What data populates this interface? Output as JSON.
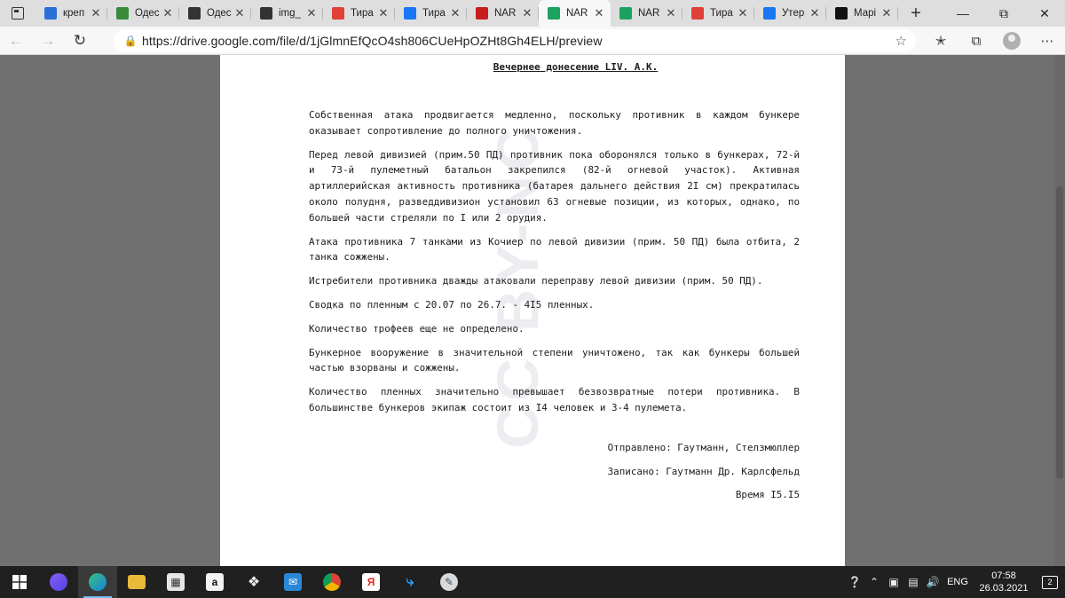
{
  "tabs": [
    {
      "label": "креп",
      "icon": "bing-icon",
      "color": "#2b6fd6",
      "active": false
    },
    {
      "label": "Одес",
      "icon": "leaf-icon",
      "color": "#3a8a3a",
      "active": false
    },
    {
      "label": "Одес",
      "icon": "crosshair-icon",
      "color": "#333333",
      "active": false
    },
    {
      "label": "img_",
      "icon": "crosshair-icon",
      "color": "#333333",
      "active": false
    },
    {
      "label": "Тира",
      "icon": "pin-icon",
      "color": "#e0403a",
      "active": false
    },
    {
      "label": "Тира",
      "icon": "facebook-icon",
      "color": "#1877f2",
      "active": false
    },
    {
      "label": "NAR",
      "icon": "checker-icon",
      "color": "#c81e1e",
      "active": false
    },
    {
      "label": "NAR",
      "icon": "google-drive-icon",
      "color": "#1aa260",
      "active": true
    },
    {
      "label": "NAR",
      "icon": "google-drive-icon",
      "color": "#1aa260",
      "active": false
    },
    {
      "label": "Тира",
      "icon": "pin-icon",
      "color": "#e0403a",
      "active": false
    },
    {
      "label": "Утер",
      "icon": "facebook-icon",
      "color": "#1877f2",
      "active": false
    },
    {
      "label": "Марі",
      "icon": "bm-icon",
      "color": "#111111",
      "active": false
    }
  ],
  "address": {
    "url": "https://drive.google.com/file/d/1jGlmnEfQcO4sh806CUeHpOZHt8Gh4ELH/preview"
  },
  "document": {
    "title": "Вечернее донесение LIV. А.К.",
    "paragraphs": [
      "Собственная атака продвигается медленно, поскольку противник в каждом бункере оказывает сопротивление до полного уничтожения.",
      "Перед левой дивизией (прим.50 ПД) противник пока оборонялся только в бункерах, 72-й и 73-й пулеметный батальон закрепился (82-й огневой участок). Активная артиллерийская активность противника (батарея дальнего действия 2I см) прекратилась около полудня, разведдивизион установил 63 огневые позиции, из которых, однако, по большей части стреляли по I или 2 орудия.",
      "Атака противника 7 танками из Кочиер по левой дивизии (прим. 50 ПД) была отбита, 2 танка сожжены.",
      "Истребители противника дважды атаковали переправу левой дивизии (прим. 50 ПД).",
      "Сводка по пленным с 20.07 по 26.7. - 4I5 пленных.",
      "Количество трофеев еще не определено.",
      "Бункерное вооружение в значительной степени уничтожено, так как бункеры большей частью взорваны и сожжены.",
      "Количество пленных значительно превышает безвозвратные потери противника. В большинстве бункеров экипаж состоит из I4 человек и 3-4 пулемета."
    ],
    "signature": {
      "sent": "Отправлено: Гаутманн, Стелзмюллер",
      "recorded": "Записано: Гаутманн Др. Карлсфельд",
      "time": "Время I5.I5"
    },
    "watermark": "CC BY-NC"
  },
  "taskbar": {
    "language": "ENG",
    "time": "07:58",
    "date": "26.03.2021",
    "notifications": "2"
  }
}
